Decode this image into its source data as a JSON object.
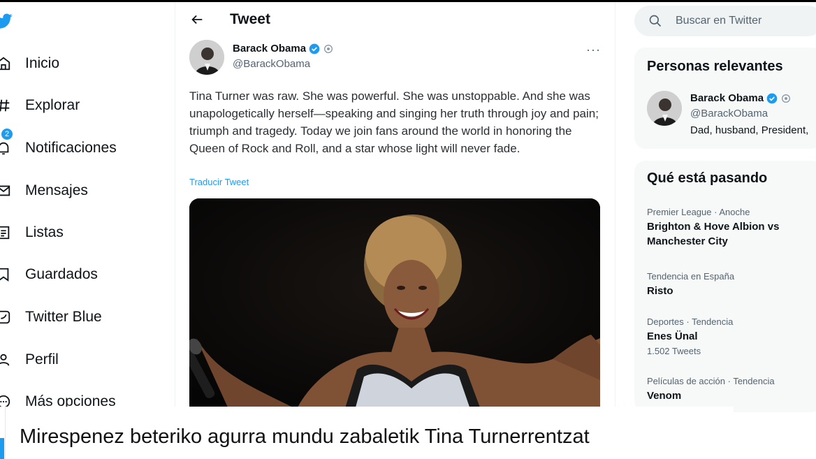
{
  "nav": {
    "items": [
      {
        "label": "Inicio",
        "icon": "home-icon"
      },
      {
        "label": "Explorar",
        "icon": "hashtag-icon"
      },
      {
        "label": "Notificaciones",
        "icon": "bell-icon",
        "badge": "2"
      },
      {
        "label": "Mensajes",
        "icon": "envelope-icon"
      },
      {
        "label": "Listas",
        "icon": "list-icon"
      },
      {
        "label": "Guardados",
        "icon": "bookmark-icon"
      },
      {
        "label": "Twitter Blue",
        "icon": "twitter-blue-icon"
      },
      {
        "label": "Perfil",
        "icon": "person-icon"
      },
      {
        "label": "Más opciones",
        "icon": "more-circle-icon"
      }
    ]
  },
  "header": {
    "title": "Tweet"
  },
  "tweet": {
    "author_name": "Barack Obama",
    "author_handle": "@BarackObama",
    "more": "···",
    "text": "Tina Turner was raw. She was powerful. She was unstoppable. And she was unapologetically herself—speaking and singing her truth through joy and pain; triumph and tragedy. Today we join fans around the world in honoring the Queen of Rock and Roll, and a star whose light will never fade.",
    "translate": "Traducir Tweet"
  },
  "search": {
    "placeholder": "Buscar en Twitter"
  },
  "relevant": {
    "title": "Personas relevantes",
    "name": "Barack Obama",
    "handle": "@BarackObama",
    "bio": "Dad, husband, President,"
  },
  "trends": {
    "title": "Qué está pasando",
    "items": [
      {
        "meta": "Premier League · Anoche",
        "topic": "Brighton & Hove Albion vs Manchester City",
        "count": ""
      },
      {
        "meta": "Tendencia en España",
        "topic": "Risto",
        "count": ""
      },
      {
        "meta": "Deportes · Tendencia",
        "topic": "Enes Ünal",
        "count": "1.502 Tweets"
      },
      {
        "meta": "Películas de acción · Tendencia",
        "topic": "Venom",
        "count": ""
      }
    ]
  },
  "caption": {
    "text": "Mirespenez beteriko agurra mundu zabaletik Tina Turnerrentzat"
  },
  "colors": {
    "accent": "#1d9bf0",
    "text": "#0f1419",
    "muted": "#536471"
  }
}
